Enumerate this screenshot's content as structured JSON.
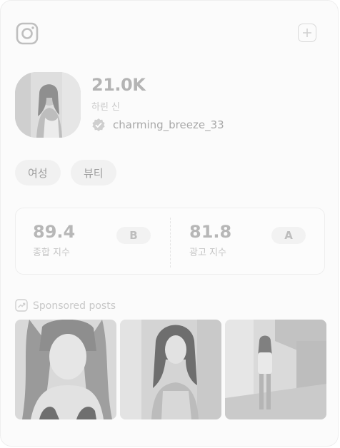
{
  "profile": {
    "followers": "21.0K",
    "real_name": "하린 신",
    "handle": "charming_breeze_33"
  },
  "icons": {
    "platform": "instagram-icon",
    "add": "plus-icon",
    "verified": "verified-badge-icon",
    "sponsored": "trending-chart-icon"
  },
  "tags": [
    "여성",
    "뷰티"
  ],
  "scores": {
    "overall": {
      "value": "89.4",
      "label": "종합 지수",
      "grade": "B"
    },
    "ad": {
      "value": "81.8",
      "label": "광고 지수",
      "grade": "A"
    }
  },
  "sponsored": {
    "title": "Sponsored posts",
    "posts": [
      {
        "alt": "post-1"
      },
      {
        "alt": "post-2"
      },
      {
        "alt": "post-3"
      }
    ]
  },
  "colors": {
    "background": "#fbfbfb",
    "tag_bg": "#f1f1f1",
    "muted_text": "#b4b4b4"
  }
}
